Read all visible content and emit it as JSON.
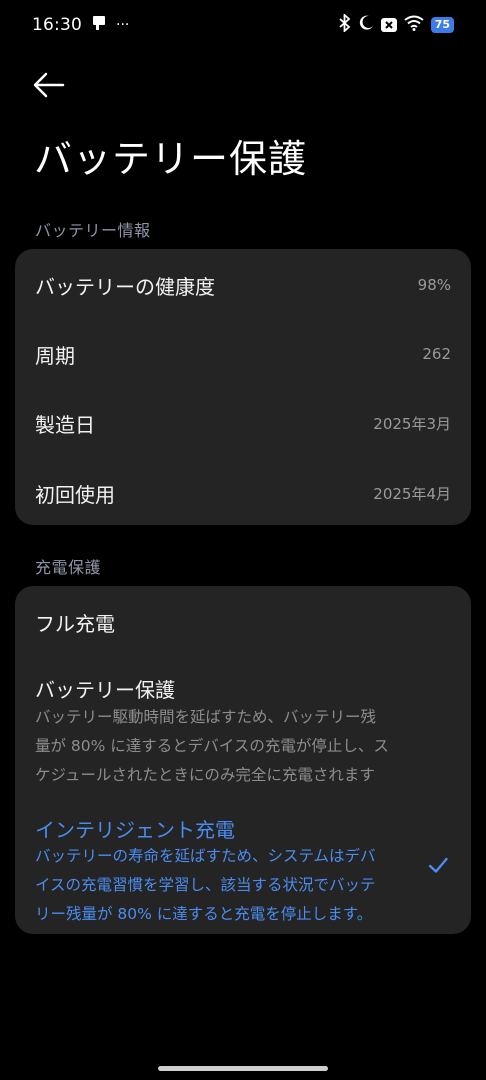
{
  "status_bar": {
    "time": "16:30",
    "more": "···",
    "battery_level": "75"
  },
  "header": {
    "title": "バッテリー保護"
  },
  "battery_info": {
    "section_title": "バッテリー情報",
    "rows": [
      {
        "label": "バッテリーの健康度",
        "value": "98%"
      },
      {
        "label": "周期",
        "value": "262"
      },
      {
        "label": "製造日",
        "value": "2025年3月"
      },
      {
        "label": "初回使用",
        "value": "2025年4月"
      }
    ]
  },
  "charge_protection": {
    "section_title": "充電保護",
    "options": [
      {
        "title": "フル充電",
        "selected": false
      },
      {
        "title": "バッテリー保護",
        "desc_lines": [
          "バッテリー駆動時間を延ばすため、バッテリー残",
          "量が 80% に達するとデバイスの充電が停止し、ス",
          "ケジュールされたときにのみ完全に充電されます"
        ],
        "selected": false
      },
      {
        "title": "インテリジェント充電",
        "desc_lines": [
          "バッテリーの寿命を延ばすため、システムはデバ",
          "イスの充電習慣を学習し、該当する状況でバッテ",
          "リー残量が 80% に達すると充電を停止します。"
        ],
        "selected": true
      }
    ]
  },
  "colors": {
    "background": "#000000",
    "card": "#242424",
    "accent": "#4a8cf0",
    "section_header": "#8f95a8"
  }
}
